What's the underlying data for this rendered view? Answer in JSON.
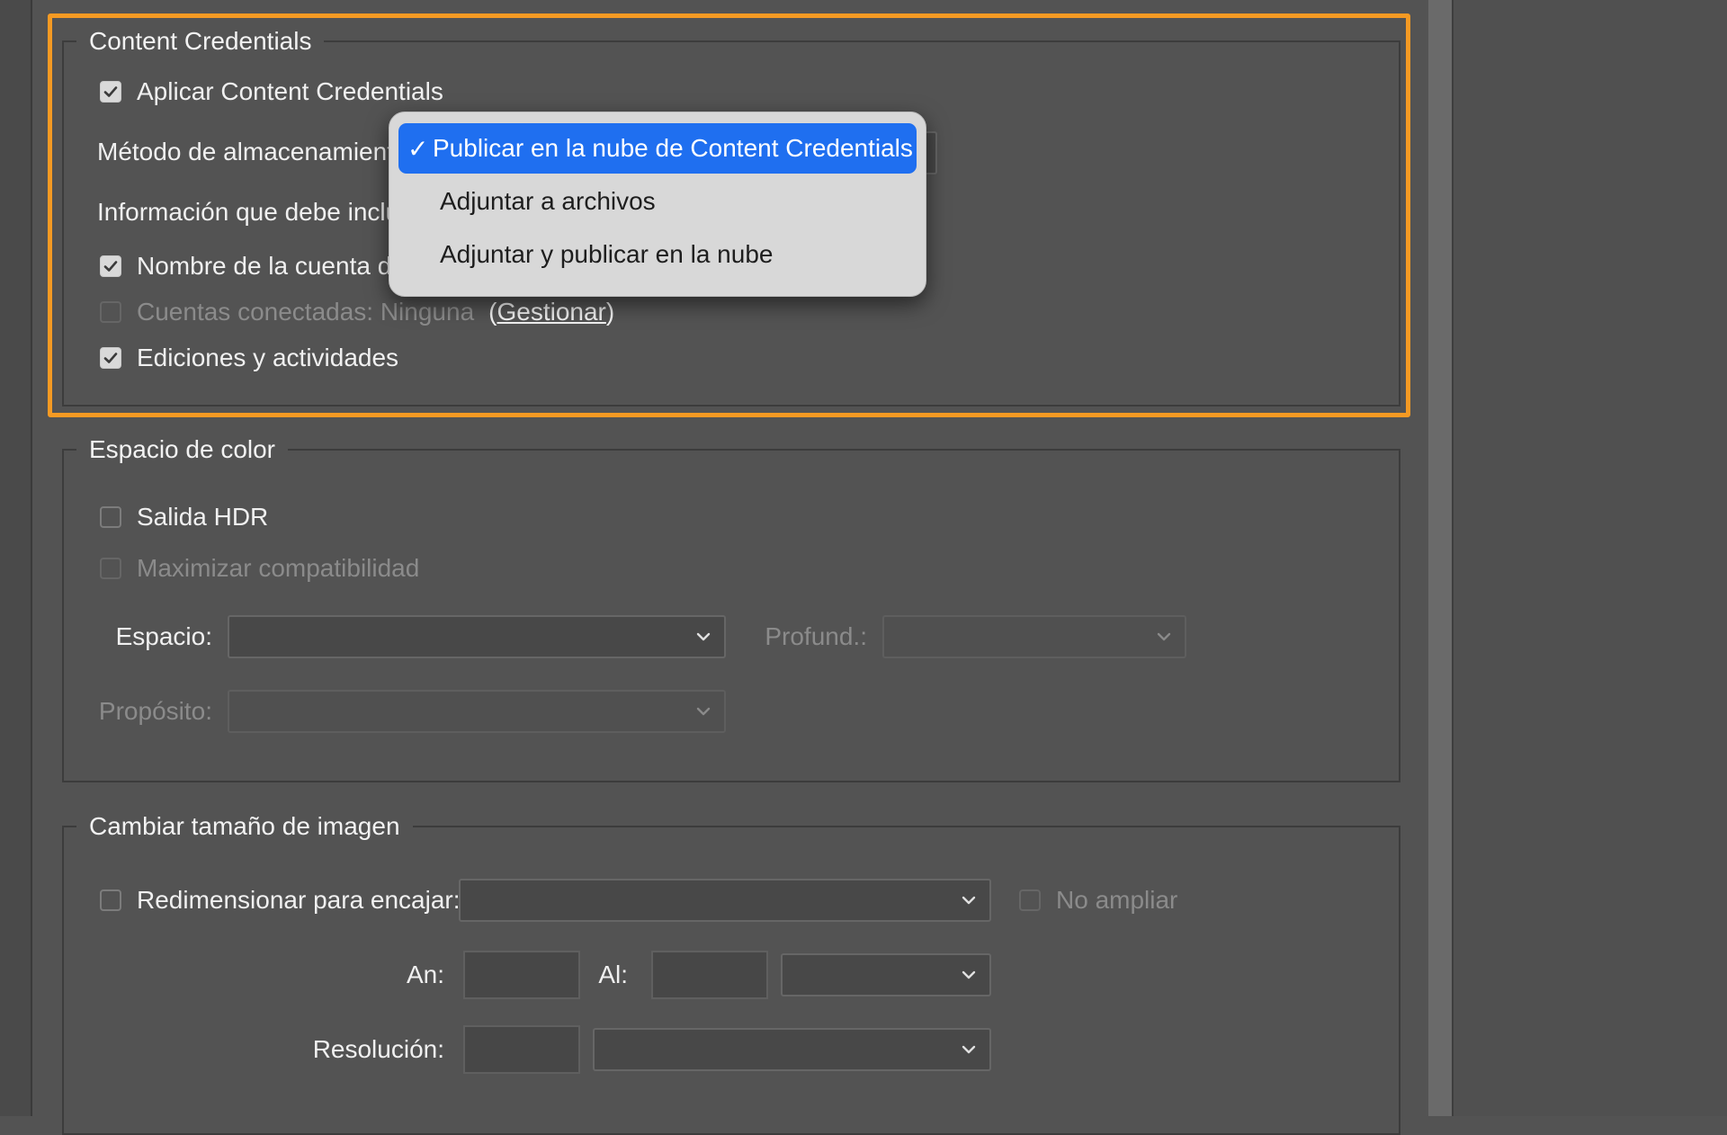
{
  "content_credentials": {
    "legend": "Content Credentials",
    "apply": {
      "label": "Aplicar Content Credentials",
      "checked": true
    },
    "storage_method_label": "Método de almacenamiento",
    "info_label": "Información que debe inclu",
    "account_name": {
      "label": "Nombre de la cuenta de",
      "checked": true
    },
    "connected_accounts": {
      "label": "Cuentas conectadas: Ninguna",
      "checked": false,
      "enabled": false
    },
    "paren_open": "(",
    "manage_link": "Gestionar",
    "paren_close": ")",
    "edits": {
      "label": "Ediciones y actividades",
      "checked": true
    }
  },
  "storage_dropdown": {
    "options": [
      {
        "label": "Publicar en la nube de Content Credentials",
        "selected": true
      },
      {
        "label": "Adjuntar a archivos",
        "selected": false
      },
      {
        "label": "Adjuntar y publicar en la nube",
        "selected": false
      }
    ],
    "check_glyph": "✓"
  },
  "color_space": {
    "legend": "Espacio de color",
    "hdr": {
      "label": "Salida HDR",
      "checked": false
    },
    "maximize": {
      "label": "Maximizar compatibilidad",
      "checked": false,
      "enabled": false
    },
    "space_label": "Espacio:",
    "space_value": "",
    "depth_label": "Profund.:",
    "depth_value": "",
    "intent_label": "Propósito:",
    "intent_value": ""
  },
  "resize": {
    "legend": "Cambiar tamaño de imagen",
    "resize_to_fit": {
      "label": "Redimensionar para encajar:",
      "checked": false
    },
    "no_enlarge": {
      "label": "No ampliar",
      "checked": false,
      "enabled": false
    },
    "width_label": "An:",
    "height_label": "Al:",
    "resolution_label": "Resolución:"
  },
  "colors": {
    "highlight": "#f59a23",
    "selection": "#1f6ff0"
  }
}
